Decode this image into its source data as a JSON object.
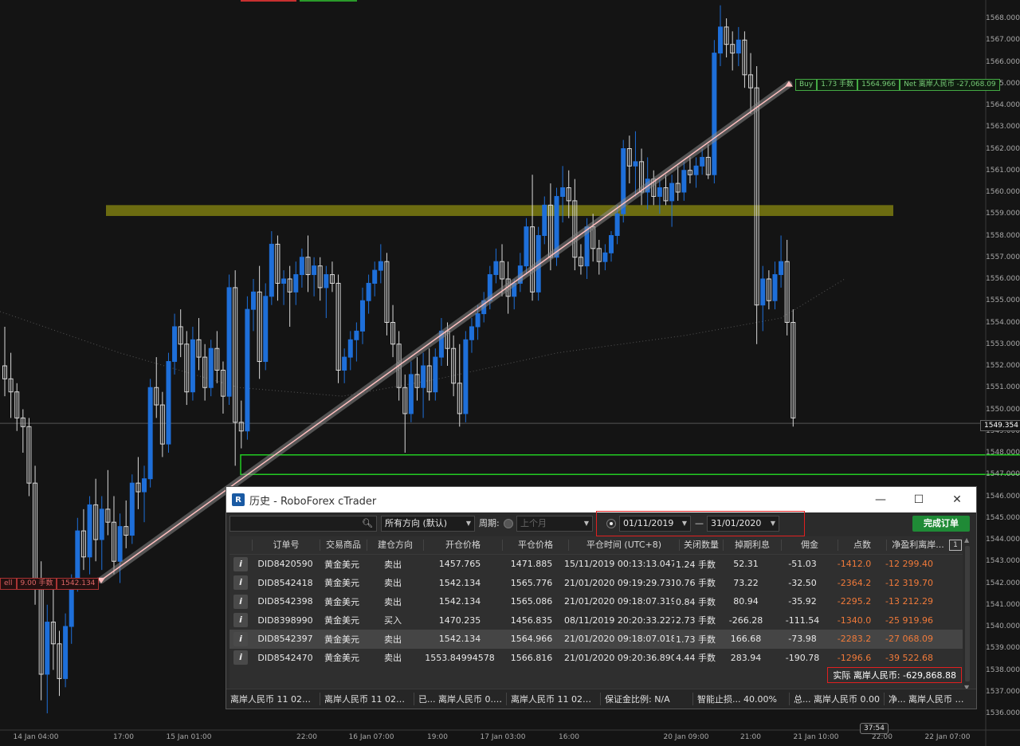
{
  "colors": {
    "bull": "#1e6fd9",
    "bear": "#d8d8d8",
    "background": "#141414",
    "sell_line": "#ffc0c0",
    "zone_yellow": "#8a8a10",
    "zone_green": "#22cc22",
    "negative": "#f07a3a",
    "accent_green": "#1f8a36"
  },
  "chart": {
    "price_ticks": [
      "1568.000",
      "1567.000",
      "1566.000",
      "1565.000",
      "1564.000",
      "1563.000",
      "1562.000",
      "1561.000",
      "1560.000",
      "1559.000",
      "1558.000",
      "1557.000",
      "1556.000",
      "1555.000",
      "1554.000",
      "1553.000",
      "1552.000",
      "1551.000",
      "1550.000",
      "1549.000",
      "1548.000",
      "1547.000",
      "1546.000",
      "1545.000",
      "1544.000",
      "1543.000",
      "1542.000",
      "1541.000",
      "1540.000",
      "1539.000",
      "1538.000",
      "1537.000",
      "1536.000"
    ],
    "time_ticks": [
      "14 Jan 04:00",
      "17:00",
      "15 Jan 01:00",
      "22:00",
      "16 Jan 07:00",
      "19:00",
      "17 Jan 03:00",
      "16:00",
      "20 Jan 09:00",
      "21:00",
      "21 Jan 10:00",
      "22:00",
      "22 Jan 07:00"
    ],
    "current_price": "1549.354",
    "time_countdown": "37:54",
    "sell_tag": {
      "side": "ell",
      "lots": "9.00 手数",
      "price": "1542.134"
    },
    "buy_tag": {
      "side": "Buy",
      "lots": "1.73 手数",
      "price": "1564.966",
      "net": "Net 离岸人民币 -27,068.09"
    },
    "candles": [
      [
        1552.0,
        1553.8,
        1550.6,
        1551.4
      ],
      [
        1551.4,
        1552.6,
        1549.6,
        1550.8
      ],
      [
        1550.8,
        1551.2,
        1549.0,
        1549.6
      ],
      [
        1549.6,
        1550.0,
        1548.0,
        1549.2
      ],
      [
        1549.2,
        1549.6,
        1546.0,
        1546.6
      ],
      [
        1546.6,
        1547.4,
        1541.0,
        1542.2
      ],
      [
        1542.2,
        1543.0,
        1536.6,
        1537.8
      ],
      [
        1537.8,
        1541.0,
        1536.0,
        1540.2
      ],
      [
        1540.2,
        1541.8,
        1538.0,
        1539.2
      ],
      [
        1539.2,
        1539.8,
        1536.8,
        1537.6
      ],
      [
        1537.6,
        1540.6,
        1537.2,
        1540.0
      ],
      [
        1540.0,
        1542.4,
        1539.2,
        1542.0
      ],
      [
        1542.0,
        1545.0,
        1541.6,
        1544.4
      ],
      [
        1544.4,
        1545.4,
        1542.6,
        1543.2
      ],
      [
        1543.2,
        1546.0,
        1542.4,
        1545.6
      ],
      [
        1545.6,
        1546.8,
        1543.0,
        1544.0
      ],
      [
        1544.0,
        1546.0,
        1542.6,
        1545.4
      ],
      [
        1545.4,
        1547.2,
        1544.2,
        1544.8
      ],
      [
        1544.8,
        1546.0,
        1542.4,
        1543.0
      ],
      [
        1543.0,
        1545.2,
        1542.0,
        1544.6
      ],
      [
        1544.6,
        1545.8,
        1543.6,
        1544.2
      ],
      [
        1544.2,
        1547.0,
        1543.8,
        1546.6
      ],
      [
        1546.6,
        1547.8,
        1545.4,
        1546.2
      ],
      [
        1546.2,
        1547.4,
        1544.8,
        1546.8
      ],
      [
        1546.8,
        1551.4,
        1546.4,
        1551.0
      ],
      [
        1551.0,
        1552.4,
        1549.6,
        1550.2
      ],
      [
        1550.2,
        1550.8,
        1547.8,
        1548.4
      ],
      [
        1548.4,
        1552.6,
        1548.0,
        1552.2
      ],
      [
        1552.2,
        1554.4,
        1551.6,
        1553.8
      ],
      [
        1553.8,
        1554.6,
        1552.4,
        1553.0
      ],
      [
        1553.0,
        1553.6,
        1550.2,
        1550.8
      ],
      [
        1550.8,
        1553.8,
        1550.4,
        1553.2
      ],
      [
        1553.2,
        1554.2,
        1551.8,
        1552.4
      ],
      [
        1552.4,
        1553.0,
        1550.4,
        1551.0
      ],
      [
        1551.0,
        1553.2,
        1550.6,
        1552.8
      ],
      [
        1552.8,
        1553.6,
        1551.2,
        1551.8
      ],
      [
        1551.8,
        1552.2,
        1549.8,
        1550.6
      ],
      [
        1550.6,
        1556.2,
        1550.2,
        1555.6
      ],
      [
        1555.6,
        1556.4,
        1547.4,
        1549.4
      ],
      [
        1549.4,
        1550.4,
        1548.2,
        1549.0
      ],
      [
        1549.0,
        1555.2,
        1548.6,
        1554.6
      ],
      [
        1554.6,
        1556.0,
        1553.6,
        1555.4
      ],
      [
        1555.4,
        1556.6,
        1551.4,
        1552.2
      ],
      [
        1552.2,
        1555.8,
        1551.8,
        1555.2
      ],
      [
        1555.2,
        1558.2,
        1554.8,
        1557.6
      ],
      [
        1557.6,
        1558.0,
        1555.0,
        1555.8
      ],
      [
        1555.8,
        1556.4,
        1554.8,
        1556.0
      ],
      [
        1556.0,
        1556.6,
        1553.8,
        1555.4
      ],
      [
        1555.4,
        1556.8,
        1554.8,
        1556.2
      ],
      [
        1556.2,
        1557.4,
        1555.6,
        1557.0
      ],
      [
        1557.0,
        1558.0,
        1555.4,
        1556.2
      ],
      [
        1556.2,
        1557.0,
        1555.2,
        1556.6
      ],
      [
        1556.6,
        1557.0,
        1555.0,
        1555.6
      ],
      [
        1555.6,
        1556.6,
        1554.2,
        1556.2
      ],
      [
        1556.2,
        1556.8,
        1555.4,
        1555.8
      ],
      [
        1555.8,
        1556.2,
        1551.2,
        1551.8
      ],
      [
        1551.8,
        1552.8,
        1551.2,
        1552.4
      ],
      [
        1552.4,
        1553.6,
        1551.8,
        1553.2
      ],
      [
        1553.2,
        1554.0,
        1552.2,
        1553.6
      ],
      [
        1553.6,
        1555.6,
        1553.0,
        1555.0
      ],
      [
        1555.0,
        1556.2,
        1554.4,
        1555.8
      ],
      [
        1555.8,
        1556.8,
        1555.2,
        1556.4
      ],
      [
        1556.4,
        1557.6,
        1555.8,
        1556.8
      ],
      [
        1556.8,
        1557.2,
        1553.4,
        1554.0
      ],
      [
        1554.0,
        1554.8,
        1552.4,
        1553.0
      ],
      [
        1553.0,
        1553.6,
        1550.4,
        1551.0
      ],
      [
        1551.0,
        1551.6,
        1548.0,
        1549.8
      ],
      [
        1549.8,
        1552.2,
        1549.4,
        1551.6
      ],
      [
        1551.6,
        1552.4,
        1550.4,
        1551.0
      ],
      [
        1551.0,
        1552.6,
        1549.6,
        1552.0
      ],
      [
        1552.0,
        1552.8,
        1550.4,
        1550.8
      ],
      [
        1550.8,
        1552.8,
        1550.4,
        1552.4
      ],
      [
        1552.4,
        1554.2,
        1552.0,
        1553.6
      ],
      [
        1553.6,
        1554.0,
        1552.0,
        1552.8
      ],
      [
        1552.8,
        1553.4,
        1550.6,
        1551.2
      ],
      [
        1551.2,
        1553.0,
        1549.2,
        1549.8
      ],
      [
        1549.8,
        1553.6,
        1549.4,
        1553.2
      ],
      [
        1553.2,
        1554.2,
        1552.6,
        1553.8
      ],
      [
        1553.8,
        1554.8,
        1553.2,
        1554.4
      ],
      [
        1554.4,
        1555.4,
        1554.0,
        1555.0
      ],
      [
        1555.0,
        1556.6,
        1554.6,
        1556.2
      ],
      [
        1556.2,
        1557.4,
        1555.8,
        1556.8
      ],
      [
        1556.8,
        1557.6,
        1555.2,
        1556.0
      ],
      [
        1556.0,
        1556.8,
        1554.4,
        1555.2
      ],
      [
        1555.2,
        1556.0,
        1554.6,
        1555.8
      ],
      [
        1555.8,
        1557.2,
        1555.4,
        1556.6
      ],
      [
        1556.6,
        1558.8,
        1556.2,
        1558.4
      ],
      [
        1558.4,
        1560.8,
        1555.0,
        1555.4
      ],
      [
        1555.4,
        1558.4,
        1555.0,
        1558.0
      ],
      [
        1558.0,
        1559.8,
        1557.6,
        1559.4
      ],
      [
        1559.4,
        1560.4,
        1556.4,
        1557.0
      ],
      [
        1557.0,
        1560.2,
        1556.6,
        1559.8
      ],
      [
        1559.8,
        1561.2,
        1558.6,
        1560.2
      ],
      [
        1560.2,
        1561.0,
        1558.8,
        1559.6
      ],
      [
        1559.6,
        1560.6,
        1556.4,
        1557.0
      ],
      [
        1557.0,
        1557.6,
        1556.2,
        1556.6
      ],
      [
        1556.6,
        1558.8,
        1556.0,
        1558.4
      ],
      [
        1558.4,
        1559.0,
        1556.8,
        1557.4
      ],
      [
        1557.4,
        1557.8,
        1556.2,
        1556.8
      ],
      [
        1556.8,
        1557.6,
        1556.4,
        1557.2
      ],
      [
        1557.2,
        1558.2,
        1556.8,
        1558.0
      ],
      [
        1558.0,
        1559.4,
        1557.6,
        1559.0
      ],
      [
        1559.0,
        1562.4,
        1558.6,
        1562.0
      ],
      [
        1562.0,
        1562.6,
        1560.4,
        1561.2
      ],
      [
        1561.2,
        1562.8,
        1559.8,
        1561.4
      ],
      [
        1561.4,
        1562.0,
        1559.4,
        1560.0
      ],
      [
        1560.0,
        1561.6,
        1559.2,
        1560.6
      ],
      [
        1560.6,
        1561.0,
        1559.4,
        1559.8
      ],
      [
        1559.8,
        1560.6,
        1559.0,
        1560.2
      ],
      [
        1560.2,
        1560.8,
        1559.4,
        1559.6
      ],
      [
        1559.6,
        1560.8,
        1558.4,
        1560.4
      ],
      [
        1560.4,
        1561.2,
        1559.6,
        1560.0
      ],
      [
        1560.0,
        1561.4,
        1559.6,
        1561.0
      ],
      [
        1561.0,
        1561.6,
        1560.4,
        1560.8
      ],
      [
        1560.8,
        1561.6,
        1560.2,
        1561.2
      ],
      [
        1561.2,
        1562.0,
        1560.8,
        1561.6
      ],
      [
        1561.6,
        1562.2,
        1560.6,
        1560.8
      ],
      [
        1560.8,
        1567.0,
        1560.4,
        1566.4
      ],
      [
        1566.4,
        1568.6,
        1565.8,
        1567.6
      ],
      [
        1567.6,
        1568.0,
        1566.2,
        1566.8
      ],
      [
        1566.8,
        1567.4,
        1565.6,
        1566.4
      ],
      [
        1566.4,
        1567.6,
        1565.8,
        1567.0
      ],
      [
        1567.0,
        1567.4,
        1564.8,
        1565.4
      ],
      [
        1565.4,
        1566.4,
        1563.6,
        1564.8
      ],
      [
        1564.8,
        1565.8,
        1553.0,
        1554.8
      ],
      [
        1554.8,
        1556.6,
        1553.6,
        1556.0
      ],
      [
        1556.0,
        1556.4,
        1554.6,
        1555.0
      ],
      [
        1555.0,
        1556.8,
        1554.6,
        1556.2
      ],
      [
        1556.2,
        1558.0,
        1555.6,
        1556.8
      ],
      [
        1556.8,
        1557.8,
        1553.4,
        1554.0
      ],
      [
        1554.0,
        1554.6,
        1549.2,
        1549.6
      ]
    ],
    "trendline": {
      "from_price": 1542.134,
      "to_price": 1564.966
    },
    "zone_yellow": {
      "top": 1559.4,
      "bottom": 1558.9
    },
    "zone_green": {
      "top": 1547.9,
      "bottom": 1547.0
    }
  },
  "window": {
    "title": "历史 - RoboForex cTrader",
    "logo_letter": "R",
    "controls": {
      "minimize": "—",
      "maximize": "☐",
      "close": "✕"
    },
    "toolbar": {
      "search_placeholder": "",
      "direction": "所有方向 (默认)",
      "period_label": "周期:",
      "period_preset": "上个月",
      "date_from": "01/11/2019",
      "date_sep": "—",
      "date_to": "31/01/2020",
      "done_button": "完成订单"
    },
    "columns": [
      "订单号",
      "交易商品",
      "建仓方向",
      "开仓价格",
      "平仓价格",
      "平仓时间 (UTC+8)",
      "关闭数量",
      "掉期利息",
      "佣金",
      "点数",
      "净盈利离岸..."
    ],
    "column_count_badge": "1",
    "rows": [
      {
        "id": "DID8420590",
        "symbol": "黄金美元",
        "dir": "卖出",
        "open": "1457.765",
        "close": "1471.885",
        "time": "15/11/2019 00:13:13.047",
        "qty": "1.24 手数",
        "swap": "52.31",
        "commission": "-51.03",
        "pips": "-1412.0",
        "net": "-12 299.40"
      },
      {
        "id": "DID8542418",
        "symbol": "黄金美元",
        "dir": "卖出",
        "open": "1542.134",
        "close": "1565.776",
        "time": "21/01/2020 09:19:29.731",
        "qty": "0.76 手数",
        "swap": "73.22",
        "commission": "-32.50",
        "pips": "-2364.2",
        "net": "-12 319.70"
      },
      {
        "id": "DID8542398",
        "symbol": "黄金美元",
        "dir": "卖出",
        "open": "1542.134",
        "close": "1565.086",
        "time": "21/01/2020 09:18:07.319",
        "qty": "0.84 手数",
        "swap": "80.94",
        "commission": "-35.92",
        "pips": "-2295.2",
        "net": "-13 212.29"
      },
      {
        "id": "DID8398990",
        "symbol": "黄金美元",
        "dir": "买入",
        "open": "1470.235",
        "close": "1456.835",
        "time": "08/11/2019 20:20:33.227",
        "qty": "2.73 手数",
        "swap": "-266.28",
        "commission": "-111.54",
        "pips": "-1340.0",
        "net": "-25 919.96"
      },
      {
        "id": "DID8542397",
        "symbol": "黄金美元",
        "dir": "卖出",
        "open": "1542.134",
        "close": "1564.966",
        "time": "21/01/2020 09:18:07.018",
        "qty": "1.73 手数",
        "swap": "166.68",
        "commission": "-73.98",
        "pips": "-2283.2",
        "net": "-27 068.09",
        "selected": true
      },
      {
        "id": "DID8542470",
        "symbol": "黄金美元",
        "dir": "卖出",
        "open": "1553.84994578",
        "close": "1566.816",
        "time": "21/01/2020 09:20:36.890",
        "qty": "4.44 手数",
        "swap": "283.94",
        "commission": "-190.78",
        "pips": "-1296.6",
        "net": "-39 522.68"
      }
    ],
    "total": "实际 离岸人民币: -629,868.88",
    "status": [
      "离岸人民币 11 022....",
      "离岸人民币 11 022....",
      "已... 离岸人民币 0.00",
      "离岸人民币 11 022....",
      "保证金比例: N/A",
      "智能止损... 40.00%",
      "总... 离岸人民币 0.00",
      "净... 离岸人民币 0.00"
    ]
  }
}
